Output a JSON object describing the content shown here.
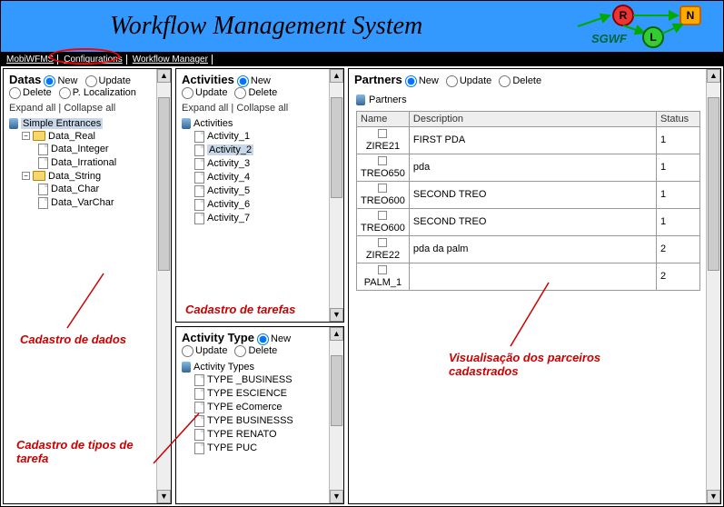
{
  "header": {
    "title": "Workflow Management System",
    "logo": {
      "lbl_sgwf": "SGWF",
      "lbl_r": "R",
      "lbl_l": "L",
      "lbl_n": "N"
    }
  },
  "menu": {
    "items": [
      "MobiWFMS",
      "Configurations",
      "Workflow Manager"
    ]
  },
  "radios": {
    "new": "New",
    "update": "Update",
    "delete": "Delete",
    "ploc": "P. Localization"
  },
  "treectrl": {
    "expand": "Expand all",
    "collapse": "Collapse all"
  },
  "datas": {
    "title": "Datas",
    "root": "Simple Entrances",
    "nodes": [
      {
        "label": "Data_Real",
        "children": [
          "Data_Integer",
          "Data_Irrational"
        ]
      },
      {
        "label": "Data_String",
        "children": [
          "Data_Char",
          "Data_VarChar"
        ]
      }
    ]
  },
  "activities": {
    "title": "Activities",
    "root": "Activities",
    "items": [
      "Activity_1",
      "Activity_2",
      "Activity_3",
      "Activity_4",
      "Activity_5",
      "Activity_6",
      "Activity_7"
    ],
    "selected": "Activity_2"
  },
  "activityType": {
    "title": "Activity Type",
    "root": "Activity Types",
    "items": [
      "TYPE _BUSINESS",
      "TYPE ESCIENCE",
      "TYPE eComerce",
      "TYPE BUSINESSS",
      "TYPE RENATO",
      "TYPE PUC"
    ]
  },
  "partners": {
    "title": "Partners",
    "listLabel": "Partners",
    "cols": [
      "Name",
      "Description",
      "Status"
    ],
    "rows": [
      {
        "name": "ZIRE21",
        "desc": "FIRST PDA",
        "status": "1"
      },
      {
        "name": "TREO650",
        "desc": "pda",
        "status": "1"
      },
      {
        "name": "TREO600",
        "desc": "SECOND TREO",
        "status": "1"
      },
      {
        "name": "TREO600",
        "desc": "SECOND TREO",
        "status": "1"
      },
      {
        "name": "ZIRE22",
        "desc": "pda da palm",
        "status": "2"
      },
      {
        "name": "PALM_1",
        "desc": "",
        "status": "2"
      }
    ]
  },
  "annotations": {
    "dados": "Cadastro de dados",
    "tarefas": "Cadastro de tarefas",
    "tipos": "Cadastro de tipos de tarefa",
    "parceiros": "Visualisação dos parceiros cadastrados"
  }
}
